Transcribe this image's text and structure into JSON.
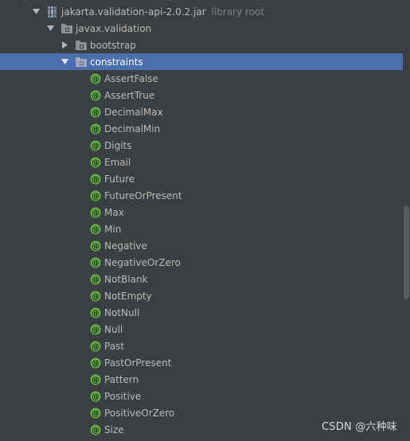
{
  "tree": {
    "root": {
      "label": "jakarta.validation-api-2.0.2.jar",
      "hint": "library root",
      "icon": "jar-library-icon",
      "expanded": true
    },
    "package": {
      "label": "javax.validation",
      "icon": "package-folder-icon",
      "expanded": true
    },
    "subpackages": [
      {
        "label": "bootstrap",
        "icon": "package-folder-icon",
        "expanded": false,
        "selected": false
      },
      {
        "label": "constraints",
        "icon": "package-folder-icon",
        "expanded": true,
        "selected": true
      }
    ],
    "annotations": [
      "AssertFalse",
      "AssertTrue",
      "DecimalMax",
      "DecimalMin",
      "Digits",
      "Email",
      "Future",
      "FutureOrPresent",
      "Max",
      "Min",
      "Negative",
      "NegativeOrZero",
      "NotBlank",
      "NotEmpty",
      "NotNull",
      "Null",
      "Past",
      "PastOrPresent",
      "Pattern",
      "Positive",
      "PositiveOrZero",
      "Size"
    ],
    "annotation_icon": "annotation-icon"
  },
  "colors": {
    "background": "#3c3f41",
    "selection": "#4b6eaf",
    "text": "#bbbbbb",
    "hint": "#7f7f7f",
    "annotation_icon": "#62b543"
  },
  "watermark": "CSDN @六种味"
}
